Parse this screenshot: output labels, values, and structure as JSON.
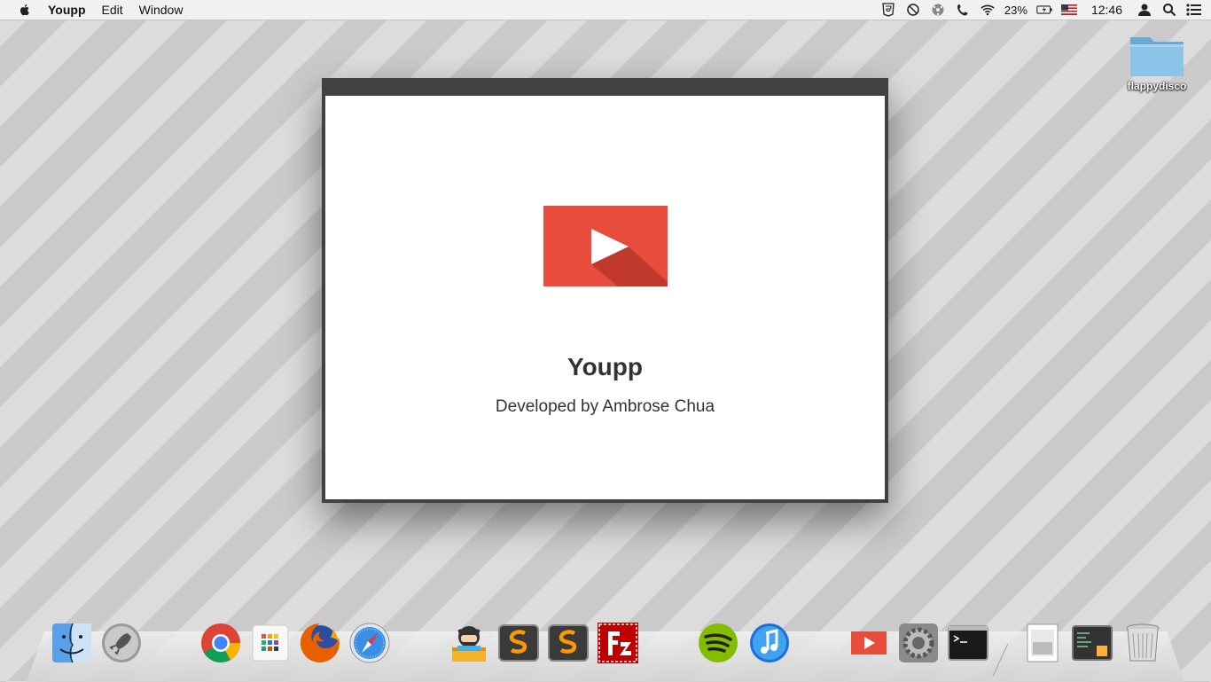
{
  "menubar": {
    "app_name": "Youpp",
    "items": [
      "Edit",
      "Window"
    ],
    "battery": "23%",
    "clock": "12:46"
  },
  "desktop": {
    "folder_label": "flappydisco"
  },
  "window": {
    "app_title": "Youpp",
    "subtitle": "Developed by Ambrose Chua"
  },
  "dock": {
    "items": [
      {
        "icon": "finder-icon"
      },
      {
        "icon": "launchpad-icon"
      },
      {
        "icon": "chrome-icon"
      },
      {
        "icon": "apps-grid-icon"
      },
      {
        "icon": "firefox-icon"
      },
      {
        "icon": "safari-icon"
      },
      {
        "icon": "github-icon"
      },
      {
        "icon": "sublime-text-icon"
      },
      {
        "icon": "sublime-text-icon"
      },
      {
        "icon": "filezilla-icon"
      },
      {
        "icon": "spotify-icon"
      },
      {
        "icon": "itunes-icon"
      },
      {
        "icon": "youpp-icon"
      },
      {
        "icon": "system-preferences-icon"
      },
      {
        "icon": "terminal-icon"
      },
      {
        "icon": "preview-icon"
      },
      {
        "icon": "activity-monitor-icon"
      },
      {
        "icon": "trash-icon"
      }
    ]
  },
  "colors": {
    "logo_red": "#e74c3c",
    "logo_shadow": "#c0392b",
    "window_frame": "#414141"
  }
}
